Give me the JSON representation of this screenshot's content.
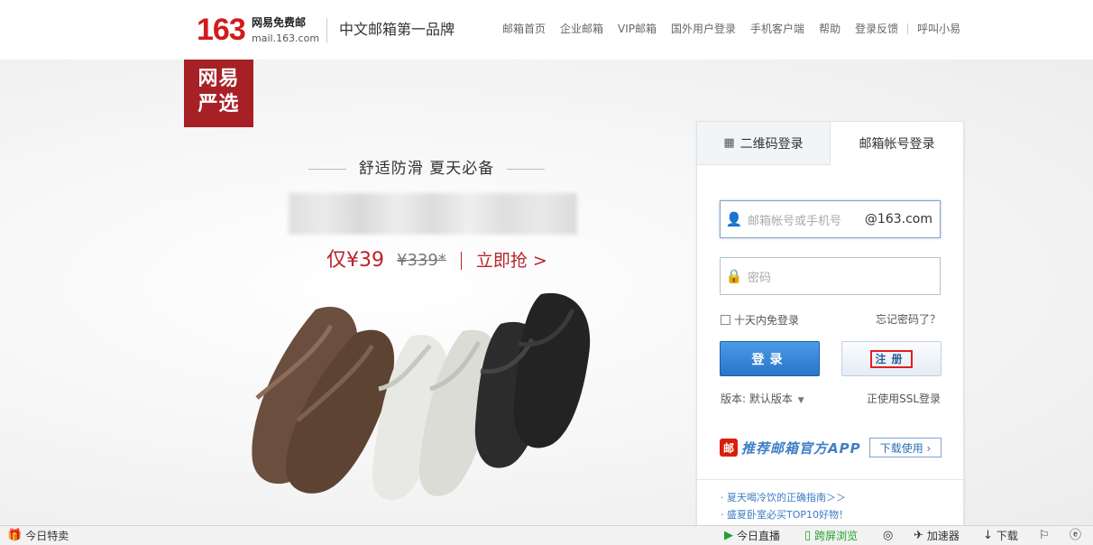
{
  "header": {
    "logo_num": "163",
    "logo_cn": "网易免费邮",
    "logo_en": "mail.163.com",
    "slogan": "中文邮箱第一品牌",
    "nav": [
      "邮箱首页",
      "企业邮箱",
      "VIP邮箱",
      "国外用户登录",
      "手机客户端",
      "帮助",
      "登录反馈",
      "呼叫小易"
    ]
  },
  "promo": {
    "brand_line1": "网易",
    "brand_line2": "严选",
    "title": "舒适防滑 夏天必备",
    "price_now": "仅¥39",
    "price_old": "¥339*",
    "buy_now": "立即抢 >"
  },
  "login": {
    "tab_qr": "二维码登录",
    "tab_account": "邮箱帐号登录",
    "qr_icon": "qr-code-icon",
    "account_placeholder": "邮箱帐号或手机号",
    "account_suffix": "@163.com",
    "password_placeholder": "密码",
    "remember_label": "十天内免登录",
    "forgot_label": "忘记密码了？",
    "login_button": "登录",
    "register_button": "注册",
    "version_label": "版本: 默认版本",
    "ssl_label": "正使用SSL登录",
    "app_badge": "邮",
    "app_text": "推荐邮箱官方APP",
    "app_download": "下载使用 ›",
    "news": [
      "· 夏天喝冷饮的正确指南＞＞",
      "· 盛夏卧室必买TOP10好物！"
    ]
  },
  "statusbar": {
    "left": "今日特卖",
    "live": "今日直播",
    "cross_screen": "跨屏浏览",
    "accelerator": "加速器",
    "download": "下载"
  },
  "colors": {
    "brand_red": "#d31b1b",
    "promo_red": "#b8242a",
    "login_blue": "#2a74c9",
    "link_blue": "#3b7cc4"
  }
}
